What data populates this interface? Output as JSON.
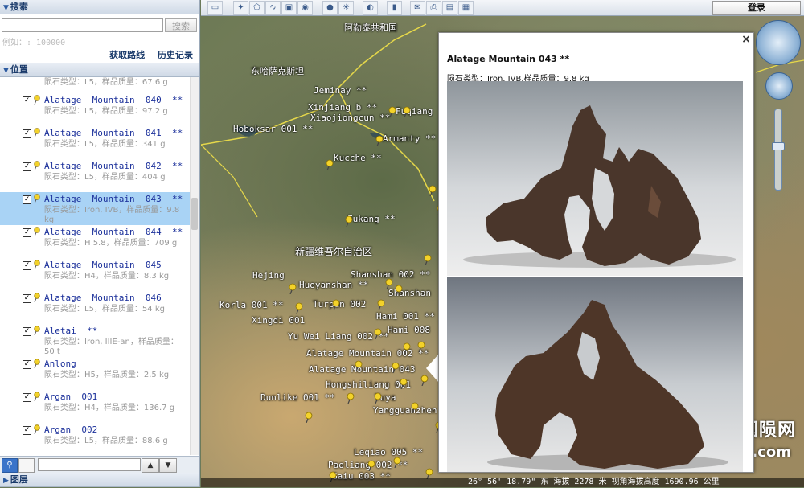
{
  "search_panel": {
    "header": "搜索",
    "input_value": "",
    "search_button": "搜索",
    "hint": "例如：: 100000",
    "get_route": "获取路线",
    "history": "历史记录"
  },
  "position_panel": {
    "header": "位置",
    "partial_top": "陨石类型：L5，样品质量：67.6 g",
    "items": [
      {
        "name": "Alatage  Mountain  040  **",
        "desc": "陨石类型：L5，样品质量：97.2 g",
        "checked": "✓"
      },
      {
        "name": "Alatage  Mountain  041  **",
        "desc": "陨石类型：L5，样品质量：341 g",
        "checked": "✓"
      },
      {
        "name": "Alatage  Mountain  042  **",
        "desc": "陨石类型：L5，样品质量：404 g",
        "checked": "✓"
      },
      {
        "name": "Alatage  Mountain  043  **",
        "desc": "陨石类型：Iron, IVB，样品质量：9.8 kg",
        "checked": "✓"
      },
      {
        "name": "Alatage  Mountain  044  **",
        "desc": "陨石类型：H 5.8，样品质量：709 g",
        "checked": "✓"
      },
      {
        "name": "Alatage  Mountain  045",
        "desc": "陨石类型：H4，样品质量：8.3 kg",
        "checked": "✓"
      },
      {
        "name": "Alatage  Mountain  046",
        "desc": "陨石类型：L5，样品质量：54 kg",
        "checked": "✓"
      },
      {
        "name": "Aletai  **",
        "desc": "陨石类型：Iron, IIIE-an，样品质量：50 t",
        "checked": "✓"
      },
      {
        "name": "Anlong",
        "desc": "陨石类型：H5，样品质量：2.5 kg",
        "checked": "✓"
      },
      {
        "name": "Argan  001",
        "desc": "陨石类型：H4，样品质量：136.7 g",
        "checked": "✓"
      },
      {
        "name": "Argan  002",
        "desc": "陨石类型：L5，样品质量：88.6 g",
        "checked": "✓"
      }
    ]
  },
  "layer_panel": {
    "header": "图层"
  },
  "toolbar": {
    "login": "登录"
  },
  "map": {
    "labels": [
      {
        "text": "阿勒泰共和国"
      },
      {
        "text": "东哈萨克斯坦"
      },
      {
        "text": "Jeminay **"
      },
      {
        "text": "Xinjiang b **"
      },
      {
        "text": "Xiaojiongcun **"
      },
      {
        "text": "Fuqiang"
      },
      {
        "text": "Hoboksar 001 **"
      },
      {
        "text": "Armanty **"
      },
      {
        "text": "Kucche **"
      },
      {
        "text": "Fukang **"
      },
      {
        "text": "新疆维吾尔自治区"
      },
      {
        "text": "Shanshan 002 **"
      },
      {
        "text": "Hejing"
      },
      {
        "text": "Huoyanshan **"
      },
      {
        "text": "Shanshan"
      },
      {
        "text": "Turpan 002"
      },
      {
        "text": "Korla 001 **"
      },
      {
        "text": "Xingdi 001"
      },
      {
        "text": "Hami 001 **"
      },
      {
        "text": "Yu Wei Liang 002 **"
      },
      {
        "text": "Hami 008"
      },
      {
        "text": "Alatage Mountain 002 **"
      },
      {
        "text": "Alatage Mountain 043"
      },
      {
        "text": "Hongshiliang 001"
      },
      {
        "text": "Dunlike 001 **"
      },
      {
        "text": "Tuya"
      },
      {
        "text": "Yangguanzhen"
      },
      {
        "text": "Leqiao 005 **"
      },
      {
        "text": "Paoliang 002 **"
      },
      {
        "text": "Gaiu 003 **"
      }
    ],
    "status": "26° 56' 18.79\" 东 海拔  2278 米   视角海拔高度 1690.96 公里",
    "watermark": "中陨网★国陨网",
    "watermark_url": "www.qqyunshi.com"
  },
  "popup": {
    "title": "Alatage Mountain 043 **",
    "desc": "陨石类型：Iron, IVB,样品质量：9.8 kg",
    "close": "×"
  },
  "colors": {
    "pin": "#f3d22a",
    "selected_row": "#a9d3f5",
    "link": "#1a2f9a",
    "header": "#1a3a6a"
  }
}
